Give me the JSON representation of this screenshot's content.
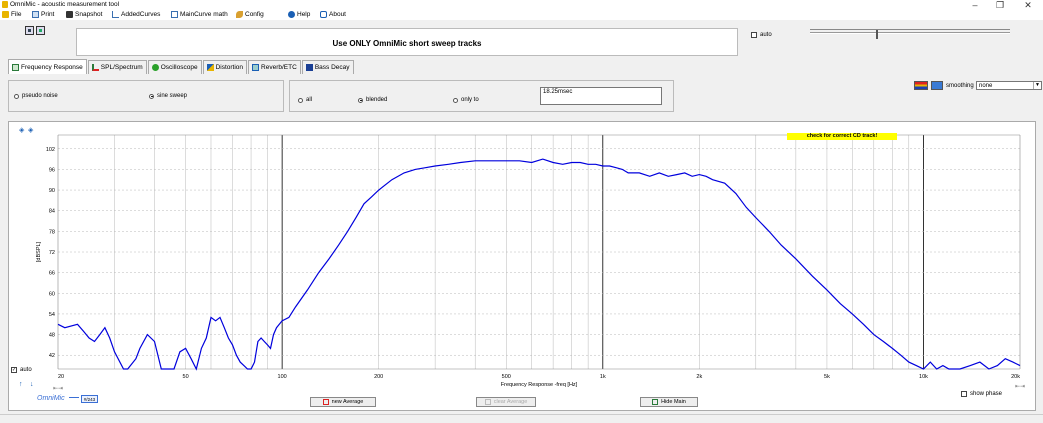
{
  "window": {
    "title": "OmniMic - acoustic measurement tool",
    "controls": [
      "–",
      "❐",
      "✕"
    ]
  },
  "menu": {
    "items": [
      {
        "label": "File",
        "icon": "folder-icon"
      },
      {
        "label": "Print",
        "icon": "printer-icon"
      },
      {
        "label": "Snapshot",
        "icon": "camera-icon"
      },
      {
        "label": "AddedCurves",
        "icon": "curves-icon"
      },
      {
        "label": "MainCurve math",
        "icon": "document-icon"
      },
      {
        "label": "Config",
        "icon": "wrench-icon"
      },
      {
        "label": "Help",
        "icon": "help-icon"
      },
      {
        "label": "About",
        "icon": "chat-icon"
      }
    ]
  },
  "banner": {
    "message": "Use ONLY OmniMic short sweep tracks"
  },
  "auto_top": {
    "label": "auto",
    "checked": false
  },
  "tabs": [
    {
      "label": "Frequency Response",
      "icon": "frequency-response-icon",
      "active": true
    },
    {
      "label": "SPL/Spectrum",
      "icon": "spectrum-icon",
      "active": false
    },
    {
      "label": "Oscilloscope",
      "icon": "oscilloscope-icon",
      "active": false
    },
    {
      "label": "Distortion",
      "icon": "distortion-icon",
      "active": false
    },
    {
      "label": "Reverb/ETC",
      "icon": "reverb-icon",
      "active": false
    },
    {
      "label": "Bass Decay",
      "icon": "bass-decay-icon",
      "active": false
    }
  ],
  "signal": {
    "options": [
      {
        "label": "pseudo noise",
        "selected": false
      },
      {
        "label": "sine sweep",
        "selected": true
      }
    ]
  },
  "window_mode": {
    "options": [
      {
        "label": "all",
        "selected": false
      },
      {
        "label": "blended",
        "selected": true
      },
      {
        "label": "only to",
        "selected": false
      }
    ],
    "time_value": "18.25msec"
  },
  "smoothing": {
    "label": "smoothing",
    "value": "none"
  },
  "chart_overlay": {
    "warning": "check for correct CD track!",
    "auto_label": "auto",
    "auto_checked": true,
    "show_phase_label": "show phase",
    "show_phase_checked": false,
    "counter_label": "#/243",
    "brand": "OmniMic"
  },
  "buttons": {
    "new_average": "new Average",
    "clear_average": "clear Average",
    "hide_main": "Hide Main"
  },
  "colors": {
    "curve": "#0000dd",
    "warning_bg": "#ffff00",
    "grid": "#b8b8b8",
    "major_grid": "#000000"
  },
  "chart_data": {
    "type": "line",
    "title": "",
    "xlabel": "Frequency Response -freq [Hz]",
    "ylabel": "[dBSPL]",
    "xscale": "log",
    "xlim": [
      20,
      20000
    ],
    "ylim": [
      38,
      106
    ],
    "x_ticks": [
      {
        "value": 20,
        "label": "20"
      },
      {
        "value": 50,
        "label": "50"
      },
      {
        "value": 100,
        "label": "100"
      },
      {
        "value": 200,
        "label": "200"
      },
      {
        "value": 500,
        "label": "500"
      },
      {
        "value": 1000,
        "label": "1k"
      },
      {
        "value": 2000,
        "label": "2k"
      },
      {
        "value": 5000,
        "label": "5k"
      },
      {
        "value": 10000,
        "label": "10k"
      },
      {
        "value": 20000,
        "label": "20k"
      }
    ],
    "y_ticks": [
      42,
      48,
      54,
      60,
      66,
      72,
      78,
      84,
      90,
      96,
      102
    ],
    "grid": true,
    "series": [
      {
        "name": "",
        "x": [
          20,
          21,
          23,
          24,
          25,
          26,
          27,
          28,
          29,
          30,
          32,
          33,
          35,
          36,
          38,
          40,
          42,
          44,
          46,
          48,
          50,
          52,
          54,
          56,
          58,
          60,
          62,
          64,
          66,
          68,
          70,
          72,
          74,
          76,
          78,
          80,
          82,
          84,
          86,
          88,
          90,
          92,
          94,
          96,
          98,
          100,
          105,
          110,
          120,
          130,
          140,
          150,
          160,
          170,
          180,
          190,
          200,
          220,
          240,
          260,
          280,
          300,
          330,
          360,
          400,
          450,
          500,
          550,
          600,
          650,
          700,
          750,
          800,
          850,
          900,
          950,
          1000,
          1050,
          1100,
          1150,
          1200,
          1300,
          1400,
          1500,
          1600,
          1700,
          1800,
          1900,
          2000,
          2100,
          2200,
          2400,
          2600,
          2800,
          3000,
          3300,
          3600,
          4000,
          4500,
          5000,
          5500,
          6000,
          6500,
          7000,
          7500,
          8000,
          8500,
          9000,
          9500,
          10000,
          10500,
          11000,
          11500,
          12000,
          13000,
          14000,
          15000,
          16000,
          17000,
          18000,
          19000,
          20000
        ],
        "y": [
          51,
          50,
          51,
          49,
          47,
          46,
          48,
          50,
          47,
          43,
          38,
          36,
          41,
          44,
          48,
          46,
          38,
          36,
          37,
          43,
          44,
          41,
          38,
          44,
          47,
          53,
          52,
          53,
          50,
          47,
          45,
          42,
          40,
          39,
          38,
          37,
          40,
          46,
          47,
          46,
          45,
          44,
          48,
          50,
          51,
          52,
          53,
          56,
          61,
          66,
          70,
          74,
          78,
          82,
          86,
          88,
          90,
          93,
          95,
          96,
          96.5,
          97,
          97.5,
          98,
          98.5,
          98.5,
          98.5,
          98.5,
          98,
          99,
          98,
          97.5,
          98,
          98,
          97.5,
          97.5,
          97,
          97,
          96.5,
          96,
          95,
          95,
          94,
          95,
          94,
          94.5,
          95,
          94,
          94.5,
          94,
          93,
          92,
          89,
          85,
          82,
          78,
          74,
          70,
          65,
          61,
          57,
          54,
          51,
          48,
          46,
          44,
          42,
          40,
          39,
          38,
          40,
          38,
          39,
          38,
          38,
          39,
          40,
          38,
          39,
          41,
          40,
          39
        ]
      }
    ]
  }
}
